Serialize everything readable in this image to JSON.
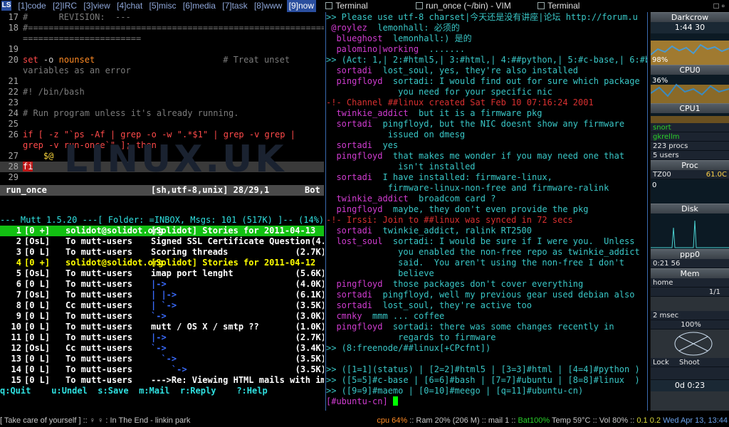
{
  "topbar": {
    "logo": "LS",
    "tags": [
      "[1]code",
      "[2]IRC",
      "[3]view",
      "[4]chat",
      "[5]misc",
      "[6]media",
      "[7]task",
      "[8]www",
      "[9]now"
    ],
    "windows": [
      "Terminal",
      "run_once (~/bin) - VIM",
      "Terminal"
    ]
  },
  "vim": {
    "lines": [
      {
        "n": "17",
        "text": "#      REVISION:  ---"
      },
      {
        "n": "18",
        "text": "#=========================================================="
      },
      {
        "n": "",
        "text": "======================="
      },
      {
        "n": "19",
        "text": ""
      },
      {
        "n": "20",
        "kw": "set",
        "opt": "-o",
        "var": "nounset",
        "cmt": "# Treat unset"
      },
      {
        "n": "",
        "text": "variables as an error"
      },
      {
        "n": "21",
        "text": ""
      },
      {
        "n": "22",
        "text": "#! /bin/bash"
      },
      {
        "n": "23",
        "text": ""
      },
      {
        "n": "24",
        "text": "# Run program unless it's already running."
      },
      {
        "n": "25",
        "text": ""
      },
      {
        "n": "26",
        "code": "if [ -z \"`ps -Af | grep -o -w \".*$1\" | grep -v grep |"
      },
      {
        "n": "",
        "code": "grep -v run-once`\" ]; then"
      },
      {
        "n": "27",
        "text": "    $@"
      },
      {
        "n": "28",
        "text": "fi"
      },
      {
        "n": "29",
        "text": ""
      }
    ],
    "status_file": "run_once",
    "status_info": "[sh,utf-8,unix] 28/29,1",
    "status_pos": "Bot",
    "watermark": "LINUX.UK"
  },
  "mutt": {
    "header": "--- Mutt 1.5.20 ---[ Folder: =INBOX, Msgs: 101 (517K) ]-- (14%) ",
    "rows": [
      {
        "n": "1",
        "f": "[0 +]",
        "t": "solidot@solidot.org",
        "s": "[Solidot] Stories for 2011-04-13",
        "z": "",
        "cls": "sel"
      },
      {
        "n": "2",
        "f": "[OsL]",
        "t": "To mutt-users",
        "s": "Signed SSL Certificate Question",
        "z": "(4.",
        "cls": ""
      },
      {
        "n": "3",
        "f": "[0 L]",
        "t": "To mutt-users",
        "s": "Scoring threads",
        "z": "(2.7K)",
        "cls": ""
      },
      {
        "n": "4",
        "f": "[0 +]",
        "t": "solidot@solidot.org",
        "s": "[Solidot] Stories for 2011-04-12",
        "z": "",
        "cls": "new"
      },
      {
        "n": "5",
        "f": "[OsL]",
        "t": "To mutt-users",
        "s": "imap port lenght",
        "z": "(5.6K)",
        "cls": ""
      },
      {
        "n": "6",
        "f": "[0 L]",
        "t": "To mutt-users",
        "s": "|->",
        "z": "(4.0K)",
        "cls": "tree"
      },
      {
        "n": "7",
        "f": "[OsL]",
        "t": "To mutt-users",
        "s": "| |->",
        "z": "(6.1K)",
        "cls": "tree"
      },
      {
        "n": "8",
        "f": "[0 L]",
        "t": "Cc mutt-users",
        "s": "| `->",
        "z": "(3.5K)",
        "cls": "tree"
      },
      {
        "n": "9",
        "f": "[0 L]",
        "t": "To mutt-users",
        "s": "`->",
        "z": "(3.0K)",
        "cls": "tree"
      },
      {
        "n": "10",
        "f": "[0 L]",
        "t": "To mutt-users",
        "s": "mutt / OS X / smtp ??",
        "z": "(1.0K)",
        "cls": ""
      },
      {
        "n": "11",
        "f": "[0 L]",
        "t": "To mutt-users",
        "s": "|->",
        "z": "(2.7K)",
        "cls": "tree"
      },
      {
        "n": "12",
        "f": "[OsL]",
        "t": "Cc mutt-users",
        "s": "`->",
        "z": "(3.4K)",
        "cls": "tree"
      },
      {
        "n": "13",
        "f": "[0 L]",
        "t": "To mutt-users",
        "s": "  `->",
        "z": "(3.5K)",
        "cls": "tree"
      },
      {
        "n": "14",
        "f": "[0 L]",
        "t": "To mutt-users",
        "s": "    `->",
        "z": "(3.5K)",
        "cls": "tree"
      },
      {
        "n": "15",
        "f": "[0 L]",
        "t": "To mutt-users",
        "s": "--->Re: Viewing HTML mails with image",
        "z": "",
        "cls": ""
      }
    ],
    "keys": "q:Quit    u:Undel  s:Save  m:Mail  r:Reply    ?:Help"
  },
  "irssi": {
    "lines": [
      {
        "c": "tx",
        "t": ">> Please use utf-8 charset|今天还是没有讲座|论坛 http://forum.u"
      },
      {
        "nick": " @roylez",
        "t": "  lemonhall: 必须的"
      },
      {
        "nick": "  blueghost",
        "t": "  lemonhall:) 是的"
      },
      {
        "nick": "  palomino|working",
        "t": "  ......."
      },
      {
        "c": "tx",
        "t": ">> (Act: 1,| 2:#html5,| 3:#html,| 4:##python,| 5:#c-base,| 6:#b"
      },
      {
        "nick": "  sortadi",
        "t": "  lost_soul, yes, they're also installed"
      },
      {
        "nick": "  pingfloyd",
        "t": "  sortadi: I would find out for sure which package"
      },
      {
        "c": "tx",
        "t": "              you need for your specific nic"
      },
      {
        "c": "sys",
        "t": "-!- Channel ##linux created Sat Feb 10 07:16:24 2001"
      },
      {
        "nick": "  twinkie_addict",
        "t": "  but it is a firmware pkg"
      },
      {
        "nick": "  sortadi",
        "t": "  pingfloyd, but the NIC doesnt show any firmware"
      },
      {
        "c": "tx",
        "t": "            issued on dmesg"
      },
      {
        "nick": "  sortadi",
        "t": "  yes"
      },
      {
        "nick": "  pingfloyd",
        "t": "  that makes me wonder if you may need one that"
      },
      {
        "c": "tx",
        "t": "              isn't installed"
      },
      {
        "nick": "  sortadi",
        "t": "  I have installed: firmware-linux,"
      },
      {
        "c": "tx",
        "t": "            firmware-linux-non-free and firmware-ralink"
      },
      {
        "nick": "  twinkie_addict",
        "t": "  broadcom card ?"
      },
      {
        "nick": "  pingfloyd",
        "t": "  maybe, they don't even provide the pkg"
      },
      {
        "c": "sys",
        "t": "-!- Irssi: Join to ##linux was synced in 72 secs"
      },
      {
        "nick": "  sortadi",
        "t": "  twinkie_addict, ralink RT2500"
      },
      {
        "nick": "  lost_soul",
        "t": "  sortadi: I would be sure if I were you.  Unless"
      },
      {
        "c": "tx",
        "t": "              you enabled the non-free repo as twinkie_addict"
      },
      {
        "c": "tx",
        "t": "              said.  You aren't using the non-free I don't"
      },
      {
        "c": "tx",
        "t": "              believe"
      },
      {
        "nick": "  pingfloyd",
        "t": "  those packages don't cover everything"
      },
      {
        "nick": "  sortadi",
        "t": "  pingfloyd, well my previous gear used debian also"
      },
      {
        "nick": "  sortadi",
        "t": "  lost_soul, they're active too"
      },
      {
        "nick": "  cmnky",
        "t": "  mmm ... coffee"
      },
      {
        "nick": "  pingfloyd",
        "t": "  sortadi: there was some changes recently in"
      },
      {
        "c": "tx",
        "t": "              regards to firmware"
      },
      {
        "c": "tx",
        "t": ">> (8:freenode/##linux[+CPcfnt])"
      },
      {
        "c": "tx",
        "t": ""
      },
      {
        "c": "tx",
        "t": ">> ([1=1](status) | [2=2]#html5 | [3=3]#html | [4=4]#python )"
      },
      {
        "c": "tx",
        "t": ">> ([5=5]#c-base | [6=6]#bash | [7=7]#ubuntu | [8=8]#linux  )"
      },
      {
        "c": "tx",
        "t": ">> ([9=9]#maemo | [0=10]#meego | [q=11]#ubuntu-cn)"
      }
    ],
    "input": "[#ubuntu-cn] "
  },
  "gkrellm": {
    "host": "Darkcrow",
    "clock": "1:44 30",
    "cpu_pct": "98%",
    "cpu0_label": "CPU0",
    "cpu0_pct": "36%",
    "cpu1_label": "CPU1",
    "procs": [
      "snort",
      "gkrellm",
      "223 procs",
      "5 users"
    ],
    "proc_label": "Proc",
    "tz": "TZ00",
    "temp": "61.0C",
    "zero": "0",
    "disk_label": "Disk",
    "ppp_label": "ppp0",
    "ppp_time": "0:21 56",
    "mem_label": "Mem",
    "home": "home",
    "mail_count": "1/1",
    "latency": "2 msec",
    "battery": "100%",
    "lock": "Lock",
    "shoot": "Shoot",
    "uptime": "0d   0:23"
  },
  "bottombar": {
    "left": "[ Take care of yourself ] :: ♀ ♀ : In The End - linkin park",
    "cpu": "cpu 64%",
    "ram": "Ram 20% (206 M)",
    "mail": "mail 1",
    "bat": "Bat100%",
    "temp": "Temp 59°C",
    "vol": "Vol 80%",
    "load1": "0.1",
    "load2": "0.2",
    "date": "Wed Apr 13, 13:44"
  },
  "colors": {
    "accent": "#2a4e9e",
    "mutt_sel": "#12c012",
    "nick": "#d03cd0",
    "text": "#39c7c7"
  }
}
